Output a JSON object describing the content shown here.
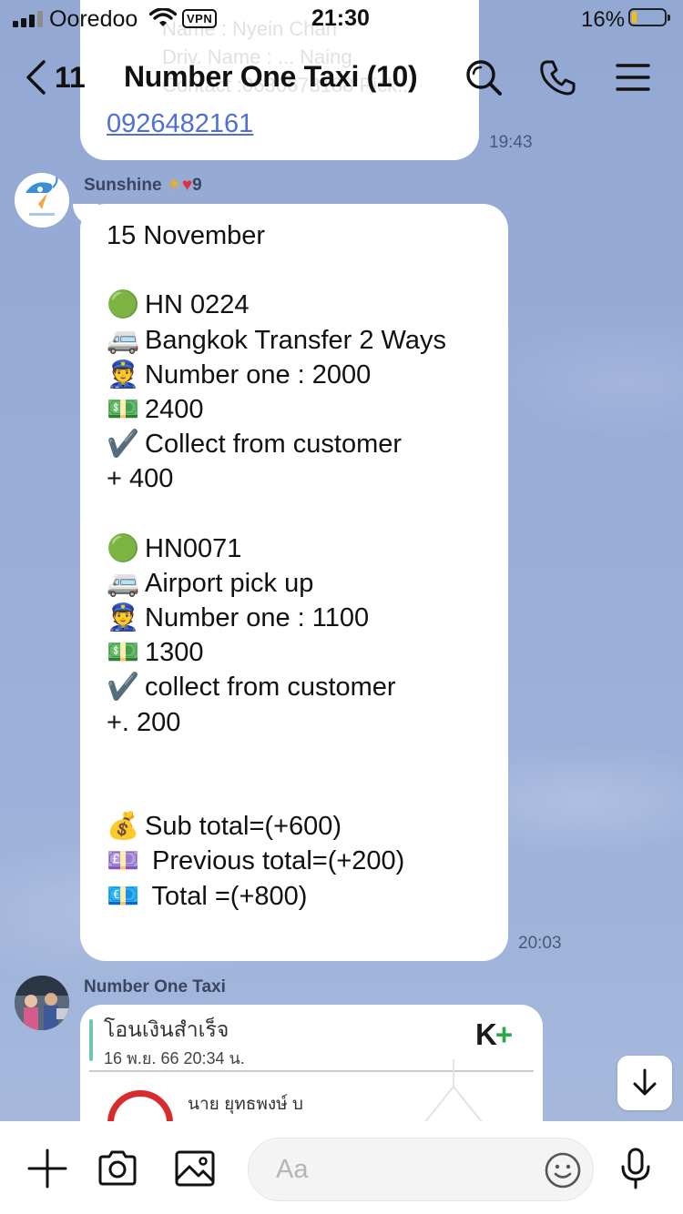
{
  "status_bar": {
    "carrier": "Ooredoo",
    "vpn": "VPN",
    "time": "21:30",
    "battery": "16%",
    "battery_level": 0.16
  },
  "header": {
    "back_count": "11",
    "title": "Number One Taxi (10)",
    "icons": [
      "search-icon",
      "phone-icon",
      "menu-icon"
    ]
  },
  "previous_message": {
    "ghost_lines": [
      "Name : Nyein Chan",
      "Driv. Name : ... Naing",
      "Contact :0636673188 Pick..."
    ],
    "link": "0926482161",
    "time": "19:43"
  },
  "message": {
    "sender": "Sunshine",
    "sender_badge": "9",
    "time": "20:03",
    "lines": [
      {
        "emoji": "",
        "text": "15 November"
      },
      {
        "emoji": "🟢",
        "text": "HN 0224"
      },
      {
        "emoji": "🚐",
        "text": "Bangkok Transfer 2 Ways"
      },
      {
        "emoji": "👮",
        "text": "Number one : 2000"
      },
      {
        "emoji": "💵",
        "text": "2400"
      },
      {
        "emoji": "✔️",
        "text": "Collect from customer"
      },
      {
        "emoji": "",
        "text": "+ 400"
      },
      {
        "emoji": "🟢",
        "text": "HN0071"
      },
      {
        "emoji": "🚐",
        "text": "Airport pick up"
      },
      {
        "emoji": "👮",
        "text": "Number one : 1100"
      },
      {
        "emoji": "💵",
        "text": "1300"
      },
      {
        "emoji": "✔️",
        "text": "collect from customer"
      },
      {
        "emoji": "",
        "text": "+. 200"
      },
      {
        "emoji": "💰",
        "text": "Sub total=(+600)"
      },
      {
        "emoji": "💷",
        "text": " Previous total=(+200)"
      },
      {
        "emoji": "💶",
        "text": " Total =(+800)"
      }
    ]
  },
  "next_message": {
    "sender": "Number One Taxi",
    "card": {
      "title": "โอนเงินสำเร็จ",
      "date": "16 พ.ย. 66  20:34 น.",
      "logo": "K+",
      "name": "นาย ยุทธพงษ์ บ"
    }
  },
  "input_bar": {
    "placeholder": "Aa",
    "icons": [
      "plus-icon",
      "camera-icon",
      "image-icon",
      "emoji-icon",
      "microphone-icon"
    ]
  },
  "colors": {
    "background": "#98acd8",
    "bubble": "#ffffff",
    "link": "#4f6fd6",
    "kplus_green": "#2aa84a"
  }
}
